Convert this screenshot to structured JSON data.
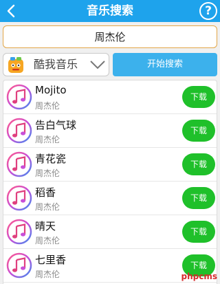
{
  "header": {
    "title": "音乐搜索",
    "help_label": "?"
  },
  "search": {
    "query": "周杰伦"
  },
  "source": {
    "selected": "酷我音乐"
  },
  "actions": {
    "search_label": "开始搜索"
  },
  "songs": [
    {
      "title": "Mojito",
      "artist": "周杰伦",
      "download_label": "下载"
    },
    {
      "title": "告白气球",
      "artist": "周杰伦",
      "download_label": "下载"
    },
    {
      "title": "青花瓷",
      "artist": "周杰伦",
      "download_label": "下载"
    },
    {
      "title": "稻香",
      "artist": "周杰伦",
      "download_label": "下载"
    },
    {
      "title": "晴天",
      "artist": "周杰伦",
      "download_label": "下载"
    },
    {
      "title": "七里香",
      "artist": "周杰伦",
      "download_label": "下载"
    }
  ],
  "watermark": "phpcms",
  "icons": {
    "back": "back-arrow-icon",
    "help": "help-circle-icon",
    "source_logo": "kuwo-logo",
    "dropdown": "chevron-down-icon",
    "song": "music-note-icon"
  },
  "colors": {
    "header": "#1ea3ec",
    "search_border": "#e2a646",
    "search_button": "#3cb1ec",
    "download_button": "#1fc02a",
    "watermark": "#d52b2b"
  }
}
